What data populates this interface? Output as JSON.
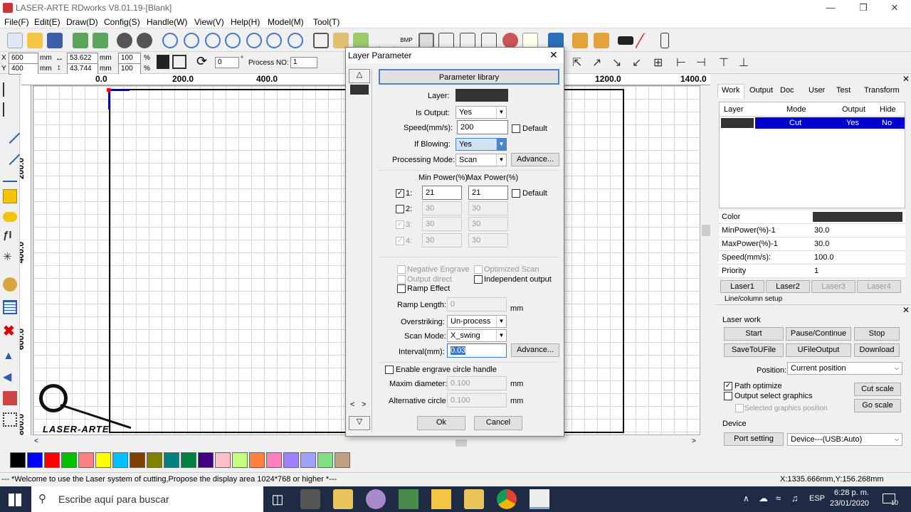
{
  "app": {
    "title": "LASER-ARTE RDworks V8.01.19-[Blank]",
    "menu": [
      "File(F)",
      "Edit(E)",
      "Draw(D)",
      "Config(S)",
      "Handle(W)",
      "View(V)",
      "Help(H)",
      "Model(M)",
      "Tool(T)"
    ]
  },
  "toolbar2": {
    "x_label": "X",
    "x_val": "600",
    "x_unit": "mm",
    "y_label": "Y",
    "y_val": "400",
    "y_unit": "mm",
    "w_val": "53.622",
    "w_unit": "mm",
    "h_val": "43.744",
    "h_unit": "mm",
    "sx_val": "100",
    "sx_unit": "%",
    "sy_val": "100",
    "sy_unit": "%",
    "rot_val": "0",
    "rot_unit": "°",
    "process_label": "Process NO:",
    "process_val": "1"
  },
  "ruler": {
    "h": [
      "0.0",
      "200.0",
      "400.0",
      "1200.0",
      "1400.0"
    ],
    "v": [
      "200.0",
      "400.0",
      "600.0",
      "800.0"
    ]
  },
  "logo": {
    "text": "LASER-ARTE"
  },
  "dialog": {
    "title": "Layer Parameter",
    "param_library": "Parameter library",
    "layer_label": "Layer:",
    "is_output_label": "Is Output:",
    "is_output_val": "Yes",
    "speed_label": "Speed(mm/s):",
    "speed_val": "200",
    "default_label": "Default",
    "blowing_label": "If Blowing:",
    "blowing_val": "Yes",
    "mode_label": "Processing Mode:",
    "mode_val": "Scan",
    "advance": "Advance...",
    "min_power_hdr": "Min Power(%)",
    "max_power_hdr": "Max Power(%)",
    "powers": [
      {
        "label": "1:",
        "min": "21",
        "max": "21"
      },
      {
        "label": "2:",
        "min": "30",
        "max": "30"
      },
      {
        "label": "3:",
        "min": "30",
        "max": "30"
      },
      {
        "label": "4:",
        "min": "30",
        "max": "30"
      }
    ],
    "neg_engrave": "Negative Engrave",
    "opt_scan": "Optimized Scan",
    "output_direct": "Output direct",
    "indep_output": "Independent output",
    "ramp_effect": "Ramp Effect",
    "ramp_length_label": "Ramp Length:",
    "ramp_length_val": "0",
    "mm": "mm",
    "overstriking_label": "Overstriking:",
    "overstriking_val": "Un-process",
    "scan_mode_label": "Scan Mode:",
    "scan_mode_val": "X_swing",
    "interval_label": "Interval(mm):",
    "interval_val": "0.03",
    "engrave_circle": "Enable engrave circle handle",
    "max_diam_label": "Maxim diameter:",
    "max_diam_val": "0.100",
    "alt_circle_label": "Alternative circle",
    "alt_circle_val": "0.100",
    "ok": "Ok",
    "cancel": "Cancel"
  },
  "right_panel": {
    "tabs": [
      "Work",
      "Output",
      "Doc",
      "User",
      "Test",
      "Transform"
    ],
    "cols": [
      "Layer",
      "Mode",
      "Output",
      "Hide"
    ],
    "row": {
      "mode": "Cut",
      "output": "Yes",
      "hide": "No"
    },
    "props": [
      {
        "k": "Color",
        "v": ""
      },
      {
        "k": "MinPower(%)-1",
        "v": "30.0"
      },
      {
        "k": "MaxPower(%)-1",
        "v": "30.0"
      },
      {
        "k": "Speed(mm/s):",
        "v": "100.0"
      },
      {
        "k": "Priority",
        "v": "1"
      }
    ],
    "laser_btns": [
      "Laser1",
      "Laser2",
      "Laser3",
      "Laser4"
    ],
    "line_setup": "Line/column setup"
  },
  "laser_work": {
    "title": "Laser work",
    "start": "Start",
    "pause": "Pause/Continue",
    "stop": "Stop",
    "save": "SaveToUFile",
    "ufile": "UFileOutput",
    "download": "Download",
    "position_label": "Position:",
    "position_val": "Current position",
    "path_opt": "Path optimize",
    "out_sel": "Output select graphics",
    "sel_pos": "Selected graphics position",
    "cut_scale": "Cut scale",
    "go_scale": "Go scale",
    "device_title": "Device",
    "port_setting": "Port setting",
    "device_val": "Device---(USB:Auto)"
  },
  "status": {
    "message": "--- *Welcome to use the Laser system of cutting,Propose the display area 1024*768 or higher *---",
    "coords": "X:1335.666mm,Y:156.268mm"
  },
  "taskbar": {
    "search": "Escribe aquí para buscar",
    "lang": "ESP",
    "time": "6:28 p. m.",
    "date": "23/01/2020",
    "notif": "10"
  },
  "colors": {
    "layer_black": "#333333",
    "accent_blue": "#0000cc",
    "palette": [
      "#000000",
      "#0000ff",
      "#ff0000",
      "#00c000",
      "#ff8080",
      "#ffff00",
      "#00c0ff",
      "#804000",
      "#808000",
      "#008080",
      "#008040",
      "#400080",
      "#ffc0cb",
      "#c0ff80",
      "#ff8040",
      "#ff80c0",
      "#a080ff",
      "#80e080",
      "#c0a080"
    ]
  }
}
